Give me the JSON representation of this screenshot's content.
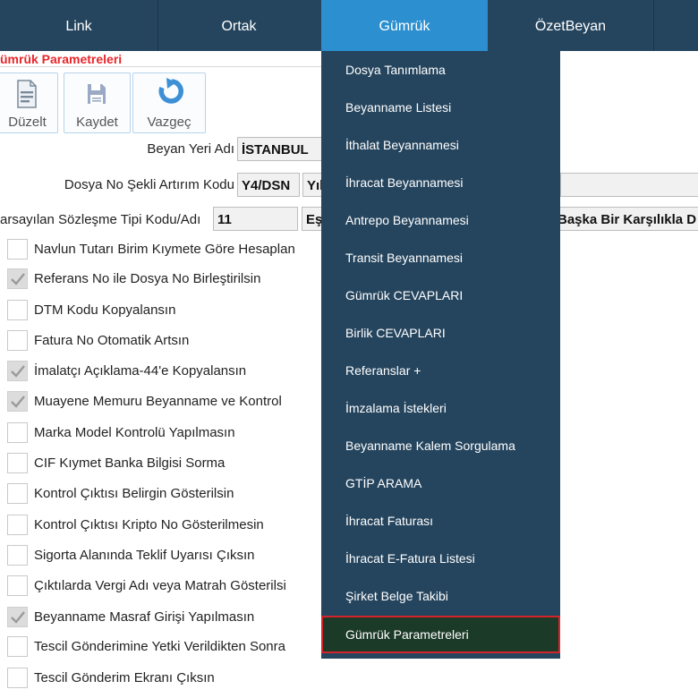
{
  "nav": {
    "tabs": [
      {
        "label": "Link"
      },
      {
        "label": "Ortak"
      },
      {
        "label": "Gümrük"
      },
      {
        "label": "ÖzetBeyan"
      }
    ]
  },
  "section_title": "ümrük Parametreleri",
  "toolbar": {
    "edit_label": "Düzelt",
    "save_label": "Kaydet",
    "cancel_label": "Vazgeç"
  },
  "form": {
    "beyan_yeri": {
      "label": "Beyan Yeri Adı",
      "value": "İSTANBUL"
    },
    "dosya_no": {
      "label": "Dosya No Şekli Artırım Kodu",
      "value1": "Y4/DSN",
      "value2": "Yıl"
    },
    "sozlesme": {
      "label": "arsayılan Sözleşme Tipi Kodu/Adı",
      "code": "11",
      "name": "Eşy",
      "extra": "Başka Bir Karşılıkla D"
    }
  },
  "checkboxes": [
    {
      "label": "Navlun Tutarı Birim Kıymete Göre Hesaplan",
      "checked": false
    },
    {
      "label": "Referans No ile Dosya No Birleştirilsin",
      "checked": true
    },
    {
      "label": "DTM Kodu Kopyalansın",
      "checked": false
    },
    {
      "label": "Fatura No Otomatik Artsın",
      "checked": false
    },
    {
      "label": "İmalatçı Açıklama-44'e Kopyalansın",
      "checked": true
    },
    {
      "label": "Muayene Memuru Beyanname ve Kontrol",
      "checked": true
    },
    {
      "label": "Marka Model Kontrolü Yapılmasın",
      "checked": false
    },
    {
      "label": "CIF Kıymet Banka Bilgisi Sorma",
      "checked": false
    },
    {
      "label": "Kontrol Çıktısı Belirgin Gösterilsin",
      "checked": false
    },
    {
      "label": "Kontrol Çıktısı Kripto No Gösterilmesin",
      "checked": false
    },
    {
      "label": "Sigorta Alanında Teklif Uyarısı Çıksın",
      "checked": false
    },
    {
      "label": "Çıktılarda Vergi Adı veya Matrah Gösterilsi",
      "checked": false
    },
    {
      "label": "Beyanname Masraf Girişi Yapılmasın",
      "checked": true
    },
    {
      "label": "Tescil Gönderimine Yetki Verildikten Sonra",
      "checked": false
    },
    {
      "label": "Tescil Gönderim Ekranı Çıksın",
      "checked": false
    }
  ],
  "menu": {
    "items": [
      {
        "label": "Dosya Tanımlama"
      },
      {
        "label": "Beyanname Listesi"
      },
      {
        "label": "İthalat Beyannamesi"
      },
      {
        "label": "İhracat Beyannamesi"
      },
      {
        "label": "Antrepo Beyannamesi"
      },
      {
        "label": "Transit Beyannamesi"
      },
      {
        "label": "Gümrük CEVAPLARI"
      },
      {
        "label": "Birlik CEVAPLARI"
      },
      {
        "label": "Referanslar +"
      },
      {
        "label": "İmzalama İstekleri"
      },
      {
        "label": "Beyanname Kalem Sorgulama"
      },
      {
        "label": "GTİP ARAMA"
      },
      {
        "label": "İhracat Faturası"
      },
      {
        "label": "İhracat E-Fatura Listesi"
      },
      {
        "label": "Şirket Belge Takibi"
      },
      {
        "label": "Gümrük Parametreleri"
      }
    ],
    "selected_index": 15
  },
  "colors": {
    "nav_bg": "#25455e",
    "nav_active": "#2b8fd0",
    "menu_bg": "#25455e",
    "menu_selected_bg": "#1c3a28",
    "menu_selected_border": "#d4242b",
    "title_red": "#e8262a"
  },
  "icons": {
    "edit": "document-edit-icon",
    "save": "floppy-save-icon",
    "cancel": "undo-arrow-icon",
    "check": "checkmark-icon"
  }
}
